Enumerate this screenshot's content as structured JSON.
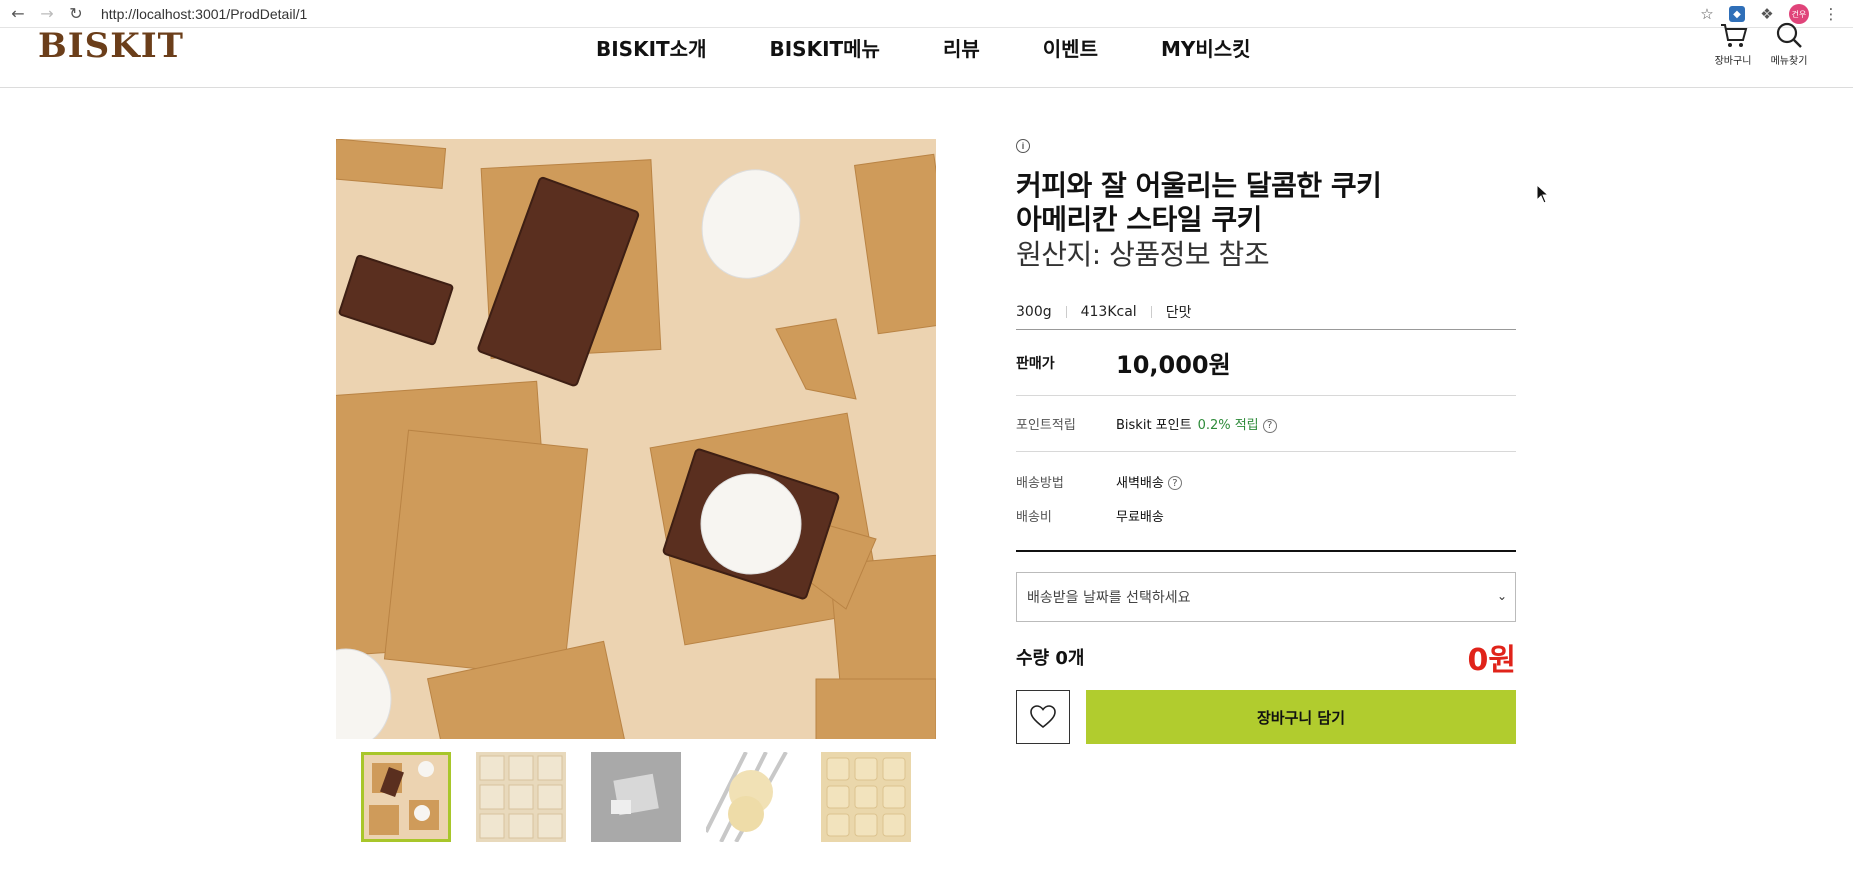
{
  "browser": {
    "url": "http://localhost:3001/ProdDetail/1",
    "profile_initials": "건우",
    "icons": [
      "back-arrow-icon",
      "forward-arrow-icon",
      "reload-icon",
      "site-info-icon",
      "bookmark-star-icon",
      "extension-icon",
      "puzzle-extensions-icon",
      "menu-dots-icon"
    ]
  },
  "header": {
    "logo": "BISKIT",
    "nav": [
      "BISKIT소개",
      "BISKIT메뉴",
      "리뷰",
      "이벤트",
      "MY비스킷"
    ],
    "cart_label": "장바구니",
    "search_label": "메뉴찾기"
  },
  "product": {
    "title_line1": "커피와 잘 어울리는 달콤한 쿠키",
    "title_line2": "아메리칸 스타일 쿠키",
    "origin": "원산지: 상품정보 참조",
    "specs": [
      "300g",
      "413Kcal",
      "단맛"
    ],
    "price_label": "판매가",
    "price": "10,000원",
    "point_label": "포인트적립",
    "point_text": "Biskit 포인트",
    "point_rate": "0.2% 적립",
    "shipping_method_label": "배송방법",
    "shipping_method": "새벽배송",
    "shipping_fee_label": "배송비",
    "shipping_fee": "무료배송",
    "date_select_placeholder": "배송받을 날짜를 선택하세요",
    "quantity": "수량 0개",
    "total": "0원",
    "cart_button": "장바구니 담기"
  },
  "colors": {
    "accent": "#b1cc2e",
    "total_red": "#e0231a",
    "logo_brown": "#6b3e1a",
    "point_green": "#2e8b3a"
  }
}
